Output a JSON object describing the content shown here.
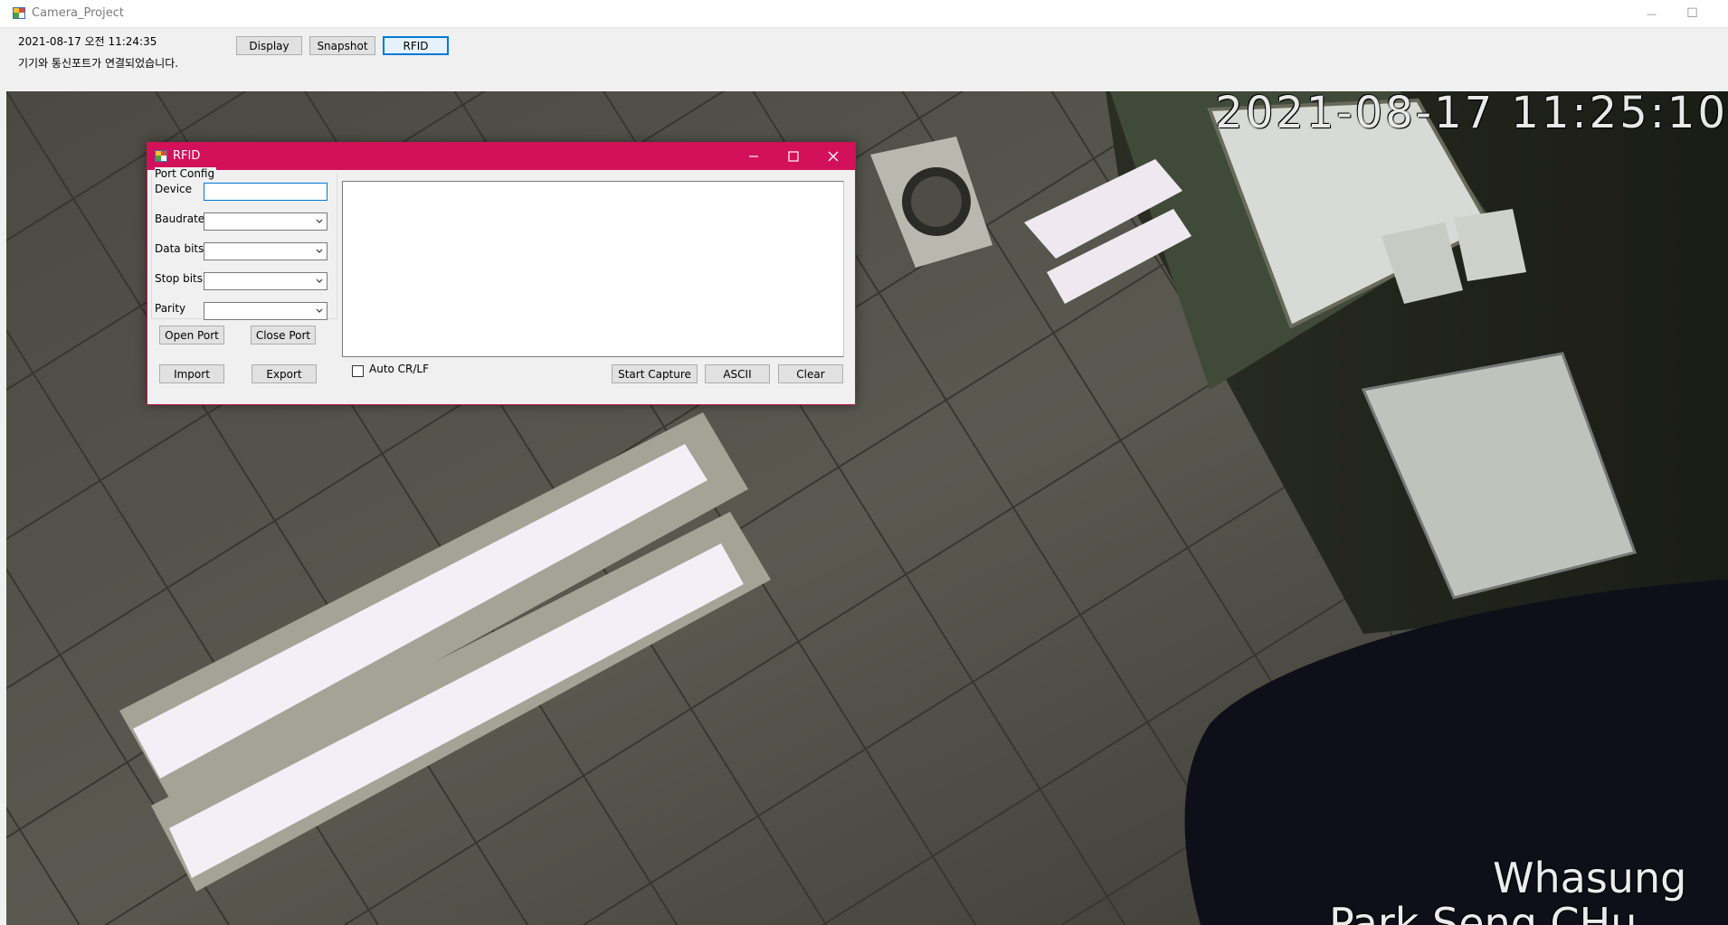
{
  "window": {
    "title": "Camera_Project",
    "minimize_glyph": "—",
    "maximize_glyph": "☐"
  },
  "status": {
    "datetime": "2021-08-17 오전 11:24:35",
    "message": "기기와 통신포트가 연결되었습니다."
  },
  "toolbar": {
    "display_label": "Display",
    "snapshot_label": "Snapshot",
    "rfid_label": "RFID"
  },
  "camera": {
    "timestamp": "2021-08-17 11:25:10",
    "overlay_line1": "Whasung",
    "overlay_line2": "Park Seng CHu"
  },
  "rfid": {
    "title": "RFID",
    "port_config_label": "Port Config",
    "device_label": "Device",
    "device_value": "",
    "baudrate_label": "Baudrate",
    "baudrate_value": "",
    "data_bits_label": "Data bits",
    "data_bits_value": "",
    "stop_bits_label": "Stop bits",
    "stop_bits_value": "",
    "parity_label": "Parity",
    "parity_value": "",
    "open_port_label": "Open Port",
    "close_port_label": "Close Port",
    "import_label": "Import",
    "export_label": "Export",
    "auto_crlf_label": "Auto CR/LF",
    "auto_crlf_checked": false,
    "start_capture_label": "Start Capture",
    "ascii_label": "ASCII",
    "clear_label": "Clear",
    "log_text": ""
  },
  "colors": {
    "dialog_accent": "#d2115a",
    "focus_blue": "#0078d7"
  }
}
